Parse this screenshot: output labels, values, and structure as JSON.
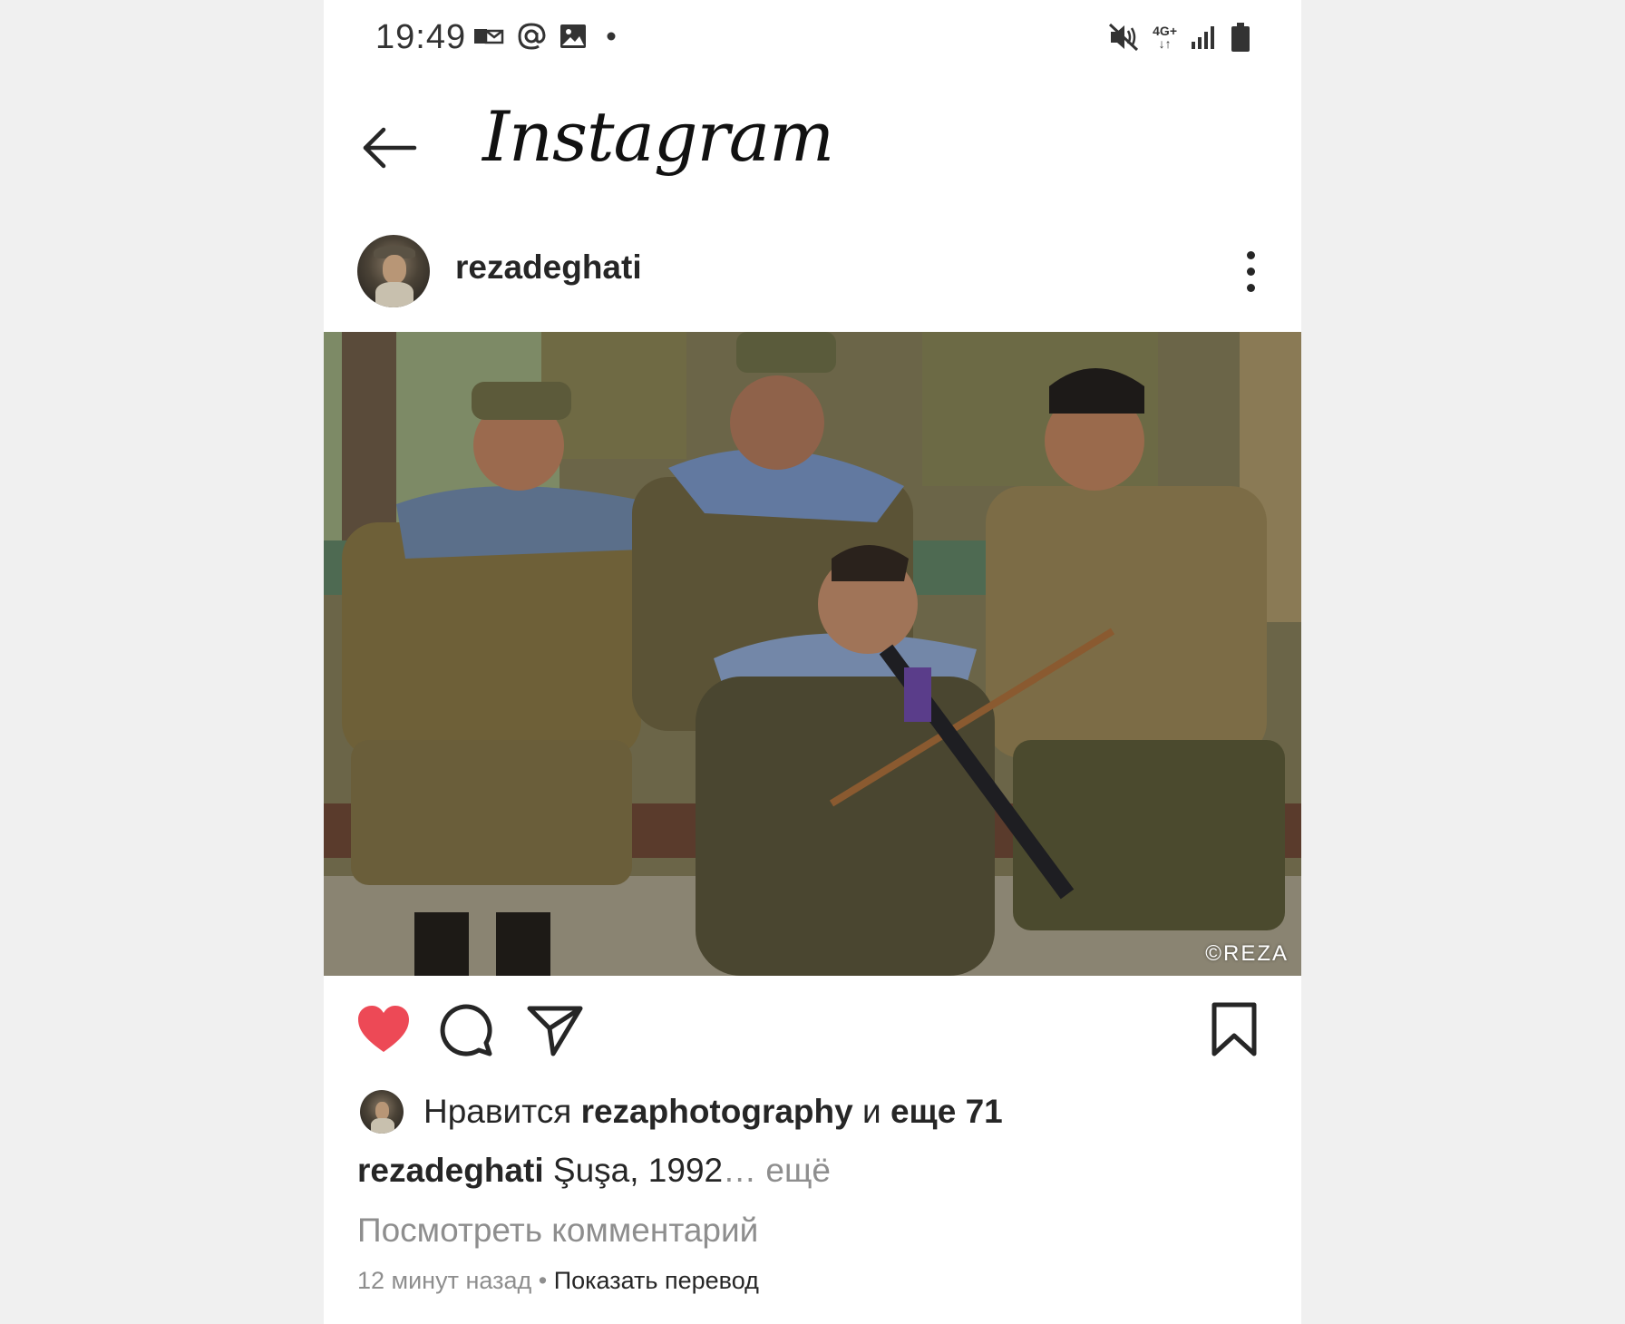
{
  "status_bar": {
    "time": "19:49",
    "left_icons": [
      "mail-icon",
      "at-icon",
      "image-icon",
      "dot-icon"
    ],
    "right_icons": [
      "mute-icon",
      "network-4g-icon",
      "signal-icon",
      "battery-icon"
    ],
    "network_label": "4G+"
  },
  "header": {
    "logo_text": "Instagram"
  },
  "post": {
    "username": "rezadeghati",
    "photo_credit": "©REZA",
    "liked": true,
    "like_color": "#ed4956",
    "likes": {
      "prefix": "Нравится",
      "user": "rezaphotography",
      "conjunction": "и",
      "others": "еще 71"
    },
    "caption": {
      "username": "rezadeghati",
      "text": "Şuşa, 1992",
      "ellipsis": "…",
      "more": "ещё"
    },
    "view_comments": "Посмотреть комментарий",
    "time_ago": "12 минут назад",
    "separator": "•",
    "translate": "Показать перевод"
  }
}
